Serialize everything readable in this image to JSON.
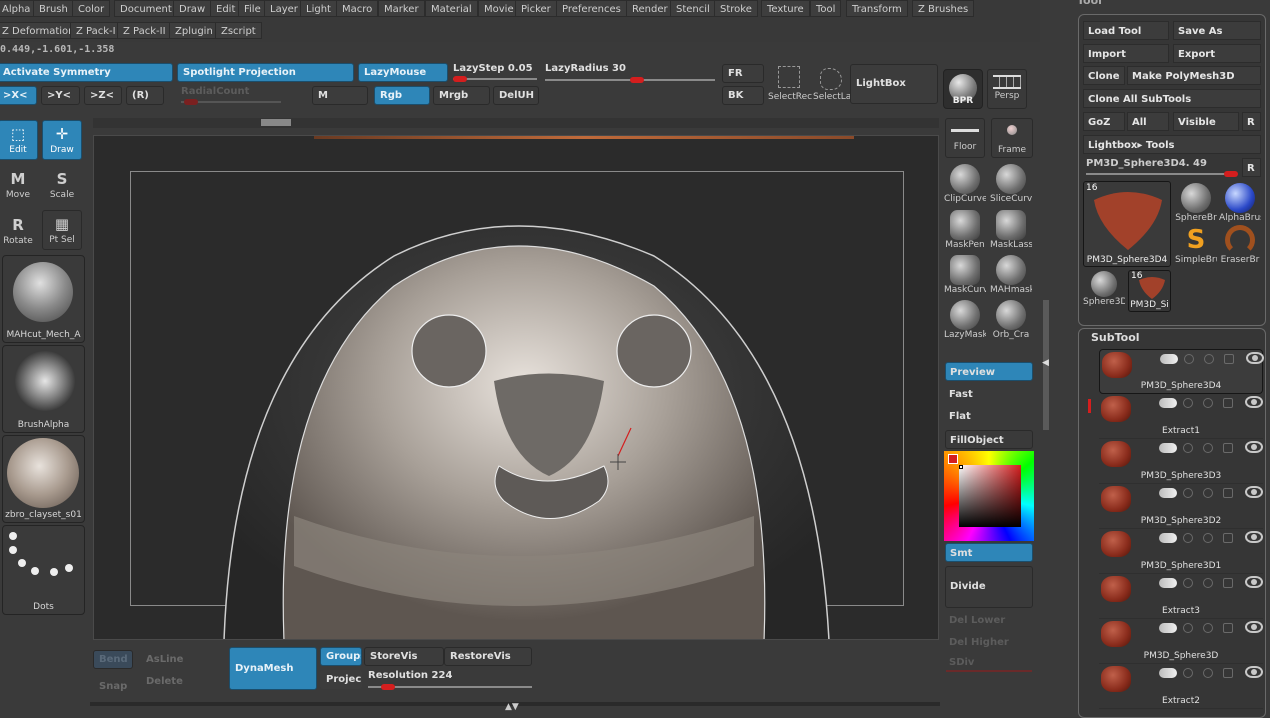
{
  "menu": {
    "row1": [
      "Alpha",
      "Brush",
      "Color",
      "Document",
      "Draw",
      "Edit",
      "File",
      "Layer",
      "Light",
      "Macro",
      "Marker",
      "Material",
      "Movie",
      "Picker",
      "Preferences",
      "Render",
      "Stencil",
      "Stroke",
      "Texture",
      "Tool",
      "Transform",
      "Z Brushes"
    ],
    "row2": [
      "Z Deformation",
      "Z Pack-I",
      "Z Pack-II",
      "Zplugin",
      "Zscript"
    ]
  },
  "coords": "0.449,-1.601,-1.358",
  "top_shelf": {
    "activate_symmetry": "Activate Symmetry",
    "spotlight_projection": "Spotlight Projection",
    "lazymouse": "LazyMouse",
    "lazystep": "LazyStep 0.05",
    "lazystep_value": 0.05,
    "lazyradius": "LazyRadius 30",
    "lazyradius_value": 30,
    "x_sym": ">X<",
    "y_sym": ">Y<",
    "z_sym": ">Z<",
    "radial": "(R)",
    "radial_count": "RadialCount",
    "m": "M",
    "rgb": "Rgb",
    "mrgb": "Mrgb",
    "deluh": "DelUH",
    "fr": "FR",
    "bk": "BK",
    "select_rect": "SelectRec",
    "select_lasso": "SelectLas",
    "lightbox": "LightBox",
    "bpr": "BPR",
    "persp": "Persp"
  },
  "left_shelf": {
    "edit": "Edit",
    "draw": "Draw",
    "move": "Move",
    "scale": "Scale",
    "rotate": "Rotate",
    "pt_sel": "Pt Sel",
    "brush": "MAHcut_Mech_A",
    "alpha": "BrushAlpha",
    "material": "zbro_clayset_s01",
    "stroke": "Dots"
  },
  "right_shelf": {
    "floor": "Floor",
    "frame": "Frame",
    "brushes": [
      "ClipCurve",
      "SliceCurv",
      "MaskPen",
      "MaskLass",
      "MaskCurv",
      "MAHmask",
      "LazyMask",
      "Orb_Cra"
    ],
    "preview": "Preview",
    "fast": "Fast",
    "flat": "Flat",
    "fillobject": "FillObject",
    "smt": "Smt",
    "divide": "Divide",
    "del_lower": "Del Lower",
    "del_higher": "Del Higher",
    "sdiv": "SDiv",
    "color_main": "#d41e1e"
  },
  "bottom_shelf": {
    "bend": "Bend",
    "asline": "AsLine",
    "snap": "Snap",
    "delete": "Delete",
    "dynamesh": "DynaMesh",
    "groups": "Groups",
    "project": "Projec",
    "storevis": "StoreVis",
    "restorevis": "RestoreVis",
    "resolution": "Resolution 224",
    "resolution_value": 224
  },
  "tool_panel": {
    "title": "Tool",
    "load_tool": "Load Tool",
    "save_as": "Save As",
    "import": "Import",
    "export": "Export",
    "clone": "Clone",
    "make_polymesh": "Make PolyMesh3D",
    "clone_all": "Clone All SubTools",
    "goz": "GoZ",
    "all": "All",
    "visible": "Visible",
    "r": "R",
    "lightbox_tools": "Lightbox▸ Tools",
    "current_tool_slider": "PM3D_Sphere3D4. 49",
    "current_tool_value": 49,
    "main_thumb_count": "16",
    "main_thumb_label": "PM3D_Sphere3D4",
    "thumbs": [
      "SphereBr",
      "AlphaBrus",
      "SimpleBru",
      "EraserBr",
      "Sphere3D",
      "PM3D_Si"
    ],
    "small_thumb_count": "16"
  },
  "subtool": {
    "title": "SubTool",
    "items": [
      {
        "name": "PM3D_Sphere3D4",
        "selected": true
      },
      {
        "name": "Extract1",
        "selected": false
      },
      {
        "name": "PM3D_Sphere3D3",
        "selected": false
      },
      {
        "name": "PM3D_Sphere3D2",
        "selected": false
      },
      {
        "name": "PM3D_Sphere3D1",
        "selected": false
      },
      {
        "name": "Extract3",
        "selected": false
      },
      {
        "name": "PM3D_Sphere3D",
        "selected": false
      },
      {
        "name": "Extract2",
        "selected": false
      }
    ]
  }
}
